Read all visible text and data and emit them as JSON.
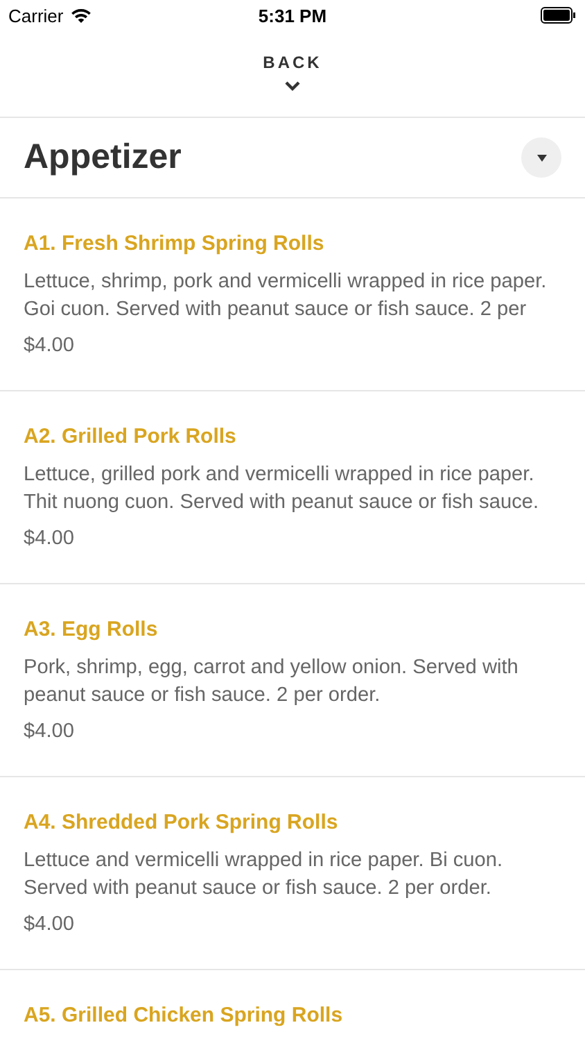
{
  "status_bar": {
    "carrier": "Carrier",
    "time": "5:31 PM"
  },
  "nav": {
    "back_label": "BACK"
  },
  "section": {
    "title": "Appetizer",
    "expanded": true
  },
  "items": [
    {
      "name": "A1. Fresh Shrimp Spring Rolls",
      "description": "Lettuce, shrimp, pork and vermicelli wrapped in rice paper. Goi cuon. Served with peanut sauce or fish sauce. 2 per",
      "price": "$4.00"
    },
    {
      "name": "A2. Grilled Pork Rolls",
      "description": "Lettuce, grilled pork and vermicelli wrapped in rice paper. Thit nuong cuon. Served with peanut sauce or fish sauce.",
      "price": "$4.00"
    },
    {
      "name": "A3. Egg Rolls",
      "description": "Pork, shrimp, egg, carrot and yellow onion. Served with peanut sauce or fish sauce. 2 per order.",
      "price": "$4.00"
    },
    {
      "name": "A4. Shredded Pork Spring Rolls",
      "description": "Lettuce and vermicelli wrapped in rice paper. Bi cuon. Served with peanut sauce or fish sauce. 2 per order.",
      "price": "$4.00"
    },
    {
      "name": "A5. Grilled Chicken Spring Rolls"
    }
  ]
}
